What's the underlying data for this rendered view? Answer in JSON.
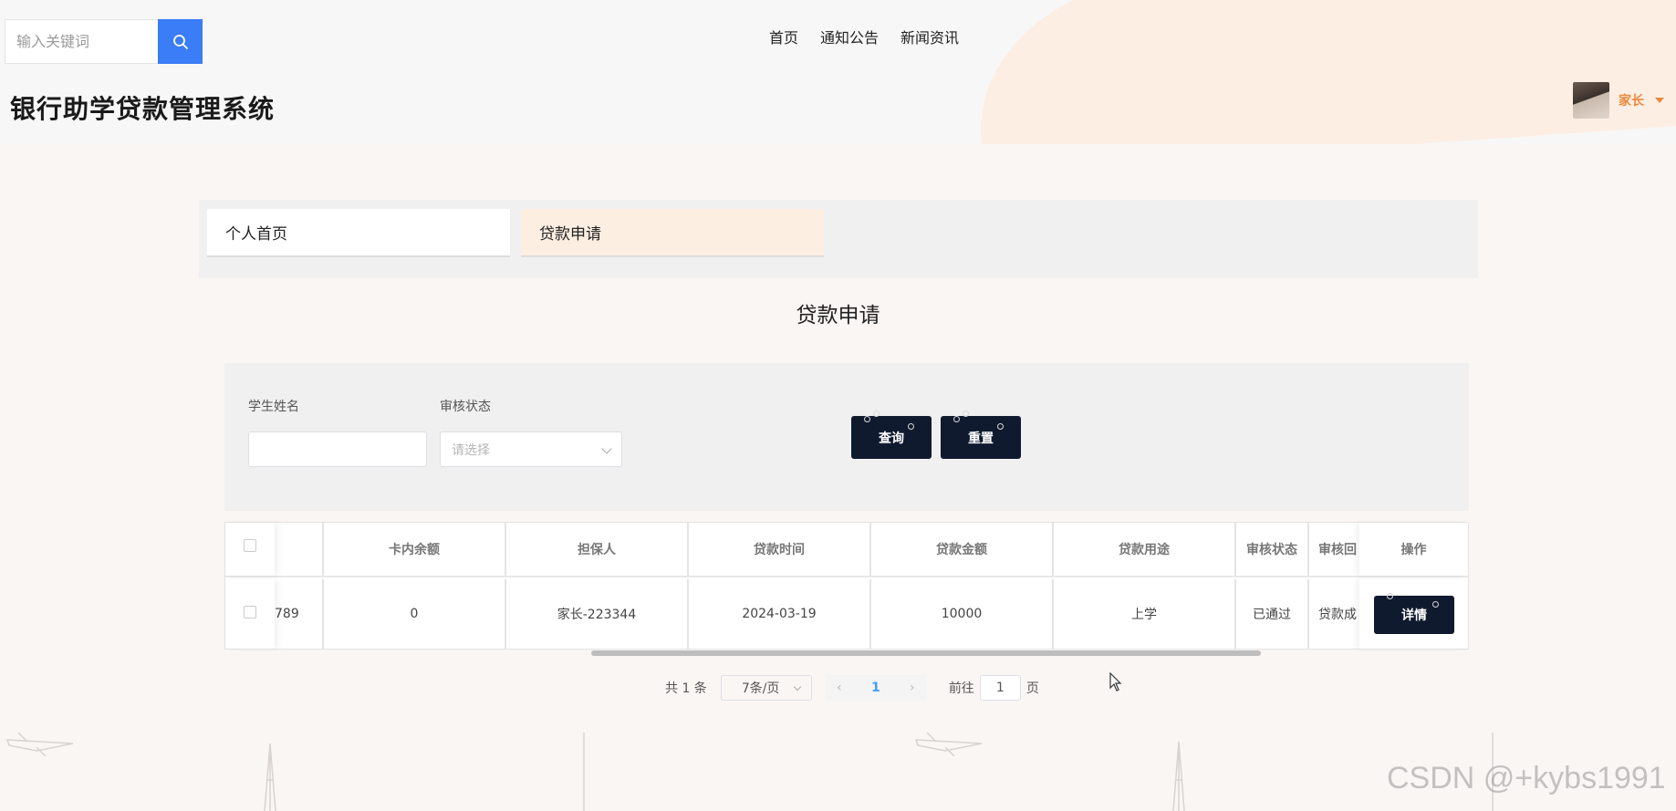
{
  "header": {
    "search_placeholder": "输入关键词",
    "nav": [
      "首页",
      "通知公告",
      "新闻资讯"
    ],
    "site_title": "银行助学贷款管理系统",
    "user_name": "家长"
  },
  "tabs": [
    "个人首页",
    "贷款申请"
  ],
  "section_title": "贷款申请",
  "filters": {
    "student_name_label": "学生姓名",
    "status_label": "审核状态",
    "status_placeholder": "请选择",
    "query_button": "查询",
    "reset_button": "重置"
  },
  "table": {
    "columns": [
      "卡内余额",
      "担保人",
      "贷款时间",
      "贷款金额",
      "贷款用途",
      "审核状态",
      "审核回",
      "操作"
    ],
    "rows": [
      {
        "partial_col": "789",
        "balance": "0",
        "guarantor": "家长-223344",
        "loan_time": "2024-03-19",
        "amount": "10000",
        "purpose": "上学",
        "status": "已通过",
        "reply": "贷款成",
        "action": "详情"
      }
    ]
  },
  "pagination": {
    "total": "共 1 条",
    "page_size": "7条/页",
    "current_page": "1",
    "goto_prefix": "前往",
    "goto_value": "1",
    "goto_suffix": "页"
  },
  "watermark": "CSDN @+kybs1991",
  "colors": {
    "accent_blue": "#3b7cf7",
    "dark_button": "#0f1a2e",
    "user_orange": "#e98a3d"
  }
}
